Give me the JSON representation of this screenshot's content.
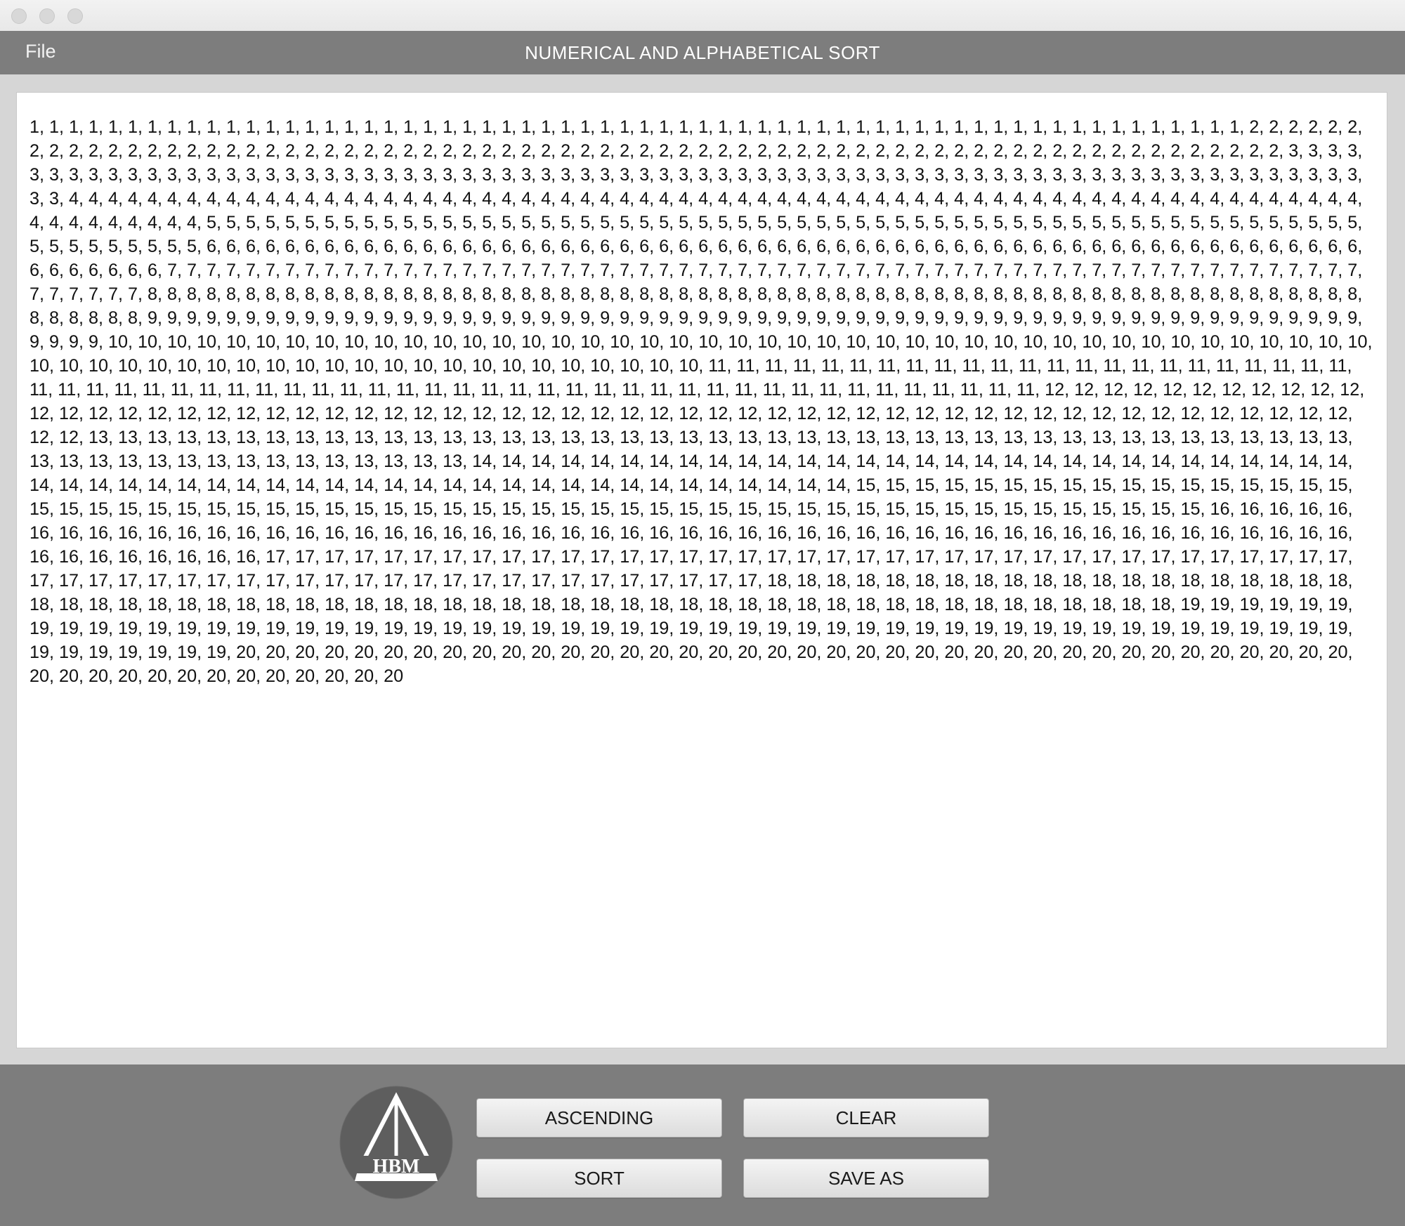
{
  "menubar": {
    "file_label": "File",
    "title": "NUMERICAL AND ALPHABETICAL SORT"
  },
  "content": {
    "text": "1, 1, 1, 1, 1, 1, 1, 1, 1, 1, 1, 1, 1, 1, 1, 1, 1, 1, 1, 1, 1, 1, 1, 1, 1, 1, 1, 1, 1, 1, 1, 1, 1, 1, 1, 1, 1, 1, 1, 1, 1, 1, 1, 1, 1, 1, 1, 1, 1, 1, 1, 1, 1, 1, 1, 1, 1, 1, 1, 1, 1, 1, 2, 2, 2, 2, 2, 2, 2, 2, 2, 2, 2, 2, 2, 2, 2, 2, 2, 2, 2, 2, 2, 2, 2, 2, 2, 2, 2, 2, 2, 2, 2, 2, 2, 2, 2, 2, 2, 2, 2, 2, 2, 2, 2, 2, 2, 2, 2, 2, 2, 2, 2, 2, 2, 2, 2, 2, 2, 2, 2, 2, 2, 2, 2, 2, 2, 2, 2, 2, 2, 2, 3, 3, 3, 3, 3, 3, 3, 3, 3, 3, 3, 3, 3, 3, 3, 3, 3, 3, 3, 3, 3, 3, 3, 3, 3, 3, 3, 3, 3, 3, 3, 3, 3, 3, 3, 3, 3, 3, 3, 3, 3, 3, 3, 3, 3, 3, 3, 3, 3, 3, 3, 3, 3, 3, 3, 3, 3, 3, 3, 3, 3, 3, 3, 3, 3, 3, 3, 3, 3, 3, 3, 3, 3, 3, 4, 4, 4, 4, 4, 4, 4, 4, 4, 4, 4, 4, 4, 4, 4, 4, 4, 4, 4, 4, 4, 4, 4, 4, 4, 4, 4, 4, 4, 4, 4, 4, 4, 4, 4, 4, 4, 4, 4, 4, 4, 4, 4, 4, 4, 4, 4, 4, 4, 4, 4, 4, 4, 4, 4, 4, 4, 4, 4, 4, 4, 4, 4, 4, 4, 4, 4, 4, 4, 4, 4, 4, 4, 4, 4, 5, 5, 5, 5, 5, 5, 5, 5, 5, 5, 5, 5, 5, 5, 5, 5, 5, 5, 5, 5, 5, 5, 5, 5, 5, 5, 5, 5, 5, 5, 5, 5, 5, 5, 5, 5, 5, 5, 5, 5, 5, 5, 5, 5, 5, 5, 5, 5, 5, 5, 5, 5, 5, 5, 5, 5, 5, 5, 5, 5, 5, 5, 5, 5, 5, 5, 5, 5, 6, 6, 6, 6, 6, 6, 6, 6, 6, 6, 6, 6, 6, 6, 6, 6, 6, 6, 6, 6, 6, 6, 6, 6, 6, 6, 6, 6, 6, 6, 6, 6, 6, 6, 6, 6, 6, 6, 6, 6, 6, 6, 6, 6, 6, 6, 6, 6, 6, 6, 6, 6, 6, 6, 6, 6, 6, 6, 6, 6, 6, 6, 6, 6, 6, 6, 7, 7, 7, 7, 7, 7, 7, 7, 7, 7, 7, 7, 7, 7, 7, 7, 7, 7, 7, 7, 7, 7, 7, 7, 7, 7, 7, 7, 7, 7, 7, 7, 7, 7, 7, 7, 7, 7, 7, 7, 7, 7, 7, 7, 7, 7, 7, 7, 7, 7, 7, 7, 7, 7, 7, 7, 7, 7, 7, 7, 7, 7, 7, 7, 7, 7, 7, 8, 8, 8, 8, 8, 8, 8, 8, 8, 8, 8, 8, 8, 8, 8, 8, 8, 8, 8, 8, 8, 8, 8, 8, 8, 8, 8, 8, 8, 8, 8, 8, 8, 8, 8, 8, 8, 8, 8, 8, 8, 8, 8, 8, 8, 8, 8, 8, 8, 8, 8, 8, 8, 8, 8, 8, 8, 8, 8, 8, 8, 8, 8, 8, 8, 8, 8, 8, 9, 9, 9, 9, 9, 9, 9, 9, 9, 9, 9, 9, 9, 9, 9, 9, 9, 9, 9, 9, 9, 9, 9, 9, 9, 9, 9, 9, 9, 9, 9, 9, 9, 9, 9, 9, 9, 9, 9, 9, 9, 9, 9, 9, 9, 9, 9, 9, 9, 9, 9, 9, 9, 9, 9, 9, 9, 9, 9, 9, 9, 9, 9, 9, 9, 9, 10, 10, 10, 10, 10, 10, 10, 10, 10, 10, 10, 10, 10, 10, 10, 10, 10, 10, 10, 10, 10, 10, 10, 10, 10, 10, 10, 10, 10, 10, 10, 10, 10, 10, 10, 10, 10, 10, 10, 10, 10, 10, 10, 10, 10, 10, 10, 10, 10, 10, 10, 10, 10, 10, 10, 10, 10, 10, 10, 10, 10, 10, 10, 10, 10, 10, 11, 11, 11, 11, 11, 11, 11, 11, 11, 11, 11, 11, 11, 11, 11, 11, 11, 11, 11, 11, 11, 11, 11, 11, 11, 11, 11, 11, 11, 11, 11, 11, 11, 11, 11, 11, 11, 11, 11, 11, 11, 11, 11, 11, 11, 11, 11, 11, 11, 11, 11, 11, 11, 11, 11, 11, 11, 11, 11, 12, 12, 12, 12, 12, 12, 12, 12, 12, 12, 12, 12, 12, 12, 12, 12, 12, 12, 12, 12, 12, 12, 12, 12, 12, 12, 12, 12, 12, 12, 12, 12, 12, 12, 12, 12, 12, 12, 12, 12, 12, 12, 12, 12, 12, 12, 12, 12, 12, 12, 12, 12, 12, 12, 12, 12, 12, 12, 13, 13, 13, 13, 13, 13, 13, 13, 13, 13, 13, 13, 13, 13, 13, 13, 13, 13, 13, 13, 13, 13, 13, 13, 13, 13, 13, 13, 13, 13, 13, 13, 13, 13, 13, 13, 13, 13, 13, 13, 13, 13, 13, 13, 13, 13, 13, 13, 13, 13, 13, 13, 13, 13, 13, 13, 13, 13, 14, 14, 14, 14, 14, 14, 14, 14, 14, 14, 14, 14, 14, 14, 14, 14, 14, 14, 14, 14, 14, 14, 14, 14, 14, 14, 14, 14, 14, 14, 14, 14, 14, 14, 14, 14, 14, 14, 14, 14, 14, 14, 14, 14, 14, 14, 14, 14, 14, 14, 14, 14, 14, 14, 14, 14, 14, 14, 15, 15, 15, 15, 15, 15, 15, 15, 15, 15, 15, 15, 15, 15, 15, 15, 15, 15, 15, 15, 15, 15, 15, 15, 15, 15, 15, 15, 15, 15, 15, 15, 15, 15, 15, 15, 15, 15, 15, 15, 15, 15, 15, 15, 15, 15, 15, 15, 15, 15, 15, 15, 15, 15, 15, 15, 15, 16, 16, 16, 16, 16, 16, 16, 16, 16, 16, 16, 16, 16, 16, 16, 16, 16, 16, 16, 16, 16, 16, 16, 16, 16, 16, 16, 16, 16, 16, 16, 16, 16, 16, 16, 16, 16, 16, 16, 16, 16, 16, 16, 16, 16, 16, 16, 16, 16, 16, 16, 16, 16, 16, 16, 16, 16, 16, 17, 17, 17, 17, 17, 17, 17, 17, 17, 17, 17, 17, 17, 17, 17, 17, 17, 17, 17, 17, 17, 17, 17, 17, 17, 17, 17, 17, 17, 17, 17, 17, 17, 17, 17, 17, 17, 17, 17, 17, 17, 17, 17, 17, 17, 17, 17, 17, 17, 17, 17, 17, 17, 17, 17, 17, 17, 17, 17, 17, 17, 17, 18, 18, 18, 18, 18, 18, 18, 18, 18, 18, 18, 18, 18, 18, 18, 18, 18, 18, 18, 18, 18, 18, 18, 18, 18, 18, 18, 18, 18, 18, 18, 18, 18, 18, 18, 18, 18, 18, 18, 18, 18, 18, 18, 18, 18, 18, 18, 18, 18, 18, 18, 18, 18, 18, 18, 18, 18, 18, 18, 19, 19, 19, 19, 19, 19, 19, 19, 19, 19, 19, 19, 19, 19, 19, 19, 19, 19, 19, 19, 19, 19, 19, 19, 19, 19, 19, 19, 19, 19, 19, 19, 19, 19, 19, 19, 19, 19, 19, 19, 19, 19, 19, 19, 19, 19, 19, 19, 19, 19, 19, 19, 19, 19, 19, 19, 19, 19, 20, 20, 20, 20, 20, 20, 20, 20, 20, 20, 20, 20, 20, 20, 20, 20, 20, 20, 20, 20, 20, 20, 20, 20, 20, 20, 20, 20, 20, 20, 20, 20, 20, 20, 20, 20, 20, 20, 20, 20, 20, 20, 20, 20, 20, 20, 20, 20, 20, 20, 20"
  },
  "logo": {
    "text": "HBM",
    "fill_color": "#5e5e5e",
    "icon": "hbm-triangle-logo-icon"
  },
  "buttons": {
    "ascending": "ASCENDING",
    "clear": "CLEAR",
    "sort": "SORT",
    "save_as": "SAVE AS"
  },
  "colors": {
    "menubar_bg": "#7d7d7d",
    "panel_bg": "#7d7d7d",
    "window_bg": "#d6d6d6"
  }
}
